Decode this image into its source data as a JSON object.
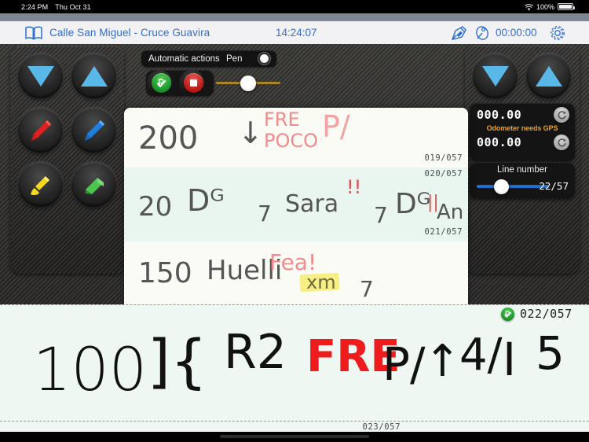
{
  "status_bar": {
    "time": "2:24 PM",
    "date": "Thu Oct 31",
    "battery_percent": "100%",
    "wifi_icon": "wifi-icon",
    "battery_icon": "battery-icon"
  },
  "nav_bar": {
    "book_icon": "book-icon",
    "title": "Calle San Miguel - Cruce Guavira",
    "clock": "14:24:07",
    "pen_icon": "fountain-pen-icon",
    "satellite_icon": "satellite-dish-icon",
    "timer": "00:00:00",
    "gear_icon": "gear-icon"
  },
  "left_tools": [
    {
      "name": "scroll-down-button",
      "icon": "triangle-down-icon",
      "color": "#5ab8e8"
    },
    {
      "name": "scroll-up-button",
      "icon": "triangle-up-icon",
      "color": "#5ab8e8"
    },
    {
      "name": "red-pen-button",
      "icon": "pen-icon",
      "color": "#e2201c"
    },
    {
      "name": "blue-pen-button",
      "icon": "pen-icon",
      "color": "#1f7fe0"
    },
    {
      "name": "yellow-brush-button",
      "icon": "brush-icon",
      "color": "#f2d91e"
    },
    {
      "name": "green-eraser-button",
      "icon": "eraser-icon",
      "color": "#4fc34f"
    }
  ],
  "right_tools": [
    {
      "name": "page-down-button",
      "icon": "triangle-down-icon",
      "color": "#5ab8e8"
    },
    {
      "name": "page-up-button",
      "icon": "triangle-up-icon",
      "color": "#5ab8e8"
    }
  ],
  "toolbar": {
    "automatic_actions_label": "Automatic actions",
    "pen_label": "Pen",
    "pen_toggle_state": "on",
    "park_action_icon": "green-park-check-icon",
    "stop_action_icon": "red-stop-icon",
    "thickness_slider_value": 50
  },
  "odometer": {
    "value_primary": "000.00",
    "value_secondary": "000.00",
    "warning": "Odometer needs GPS",
    "refresh_icon": "refresh-icon"
  },
  "line_number": {
    "label": "Line number",
    "value": "22/57",
    "slider_percent": 38
  },
  "notepad": {
    "rows": [
      {
        "label": "019/057",
        "background": "#fbfbf6",
        "strokes": [
          {
            "text": "200",
            "color": "#555555",
            "style": "pencil"
          },
          {
            "text": "↓",
            "color": "#555555",
            "style": "pencil"
          },
          {
            "text": "FRE",
            "color": "#f08a8a",
            "style": "pen"
          },
          {
            "text": "POCO",
            "color": "#f08a8a",
            "style": "pen"
          },
          {
            "text": "P/",
            "color": "#f0a0a0",
            "style": "pen"
          }
        ]
      },
      {
        "label": "020/057",
        "background": "#e9f5ef",
        "strokes": [
          {
            "text": "20",
            "color": "#555555",
            "style": "pencil"
          },
          {
            "text": "Dᴳ",
            "color": "#555555",
            "style": "pencil"
          },
          {
            "text": "7",
            "color": "#555555",
            "style": "pencil"
          },
          {
            "text": "Sara",
            "color": "#555555",
            "style": "pencil"
          },
          {
            "text": "!!",
            "color": "#e05050",
            "style": "pen"
          },
          {
            "text": "7",
            "color": "#555555",
            "style": "pencil"
          },
          {
            "text": "Dᴳ",
            "color": "#555555",
            "style": "pencil"
          },
          {
            "text": "An",
            "color": "#555555",
            "style": "pencil"
          },
          {
            "text": "||",
            "color": "#e05050",
            "style": "pen"
          }
        ]
      },
      {
        "label": "021/057",
        "background": "#fbfbf6",
        "strokes": [
          {
            "text": "150",
            "color": "#555555",
            "style": "pencil"
          },
          {
            "text": "Huelli",
            "color": "#555555",
            "style": "pencil"
          },
          {
            "text": "Fea!",
            "color": "#f08a8a",
            "style": "pen"
          },
          {
            "text": "xm",
            "color": "#555555",
            "style": "highlight"
          },
          {
            "text": "7",
            "color": "#555555",
            "style": "pencil"
          }
        ]
      }
    ],
    "active_row": {
      "label": "022/057",
      "badge_icon": "green-park-check-icon",
      "background": "#eef7f1",
      "strokes": [
        {
          "text": "100",
          "color": "#111111",
          "style": "marker"
        },
        {
          "text": "]{",
          "color": "#111111",
          "style": "marker"
        },
        {
          "text": "R2",
          "color": "#111111",
          "style": "marker"
        },
        {
          "text": "FRE",
          "color": "#ee1c1c",
          "style": "marker"
        },
        {
          "text": "P/",
          "color": "#111111",
          "style": "marker"
        },
        {
          "text": "↑",
          "color": "#111111",
          "style": "marker"
        },
        {
          "text": "4/",
          "color": "#111111",
          "style": "marker"
        },
        {
          "text": "I",
          "color": "#111111",
          "style": "marker"
        },
        {
          "text": "5",
          "color": "#111111",
          "style": "marker"
        }
      ]
    },
    "next_row_label": "023/057"
  }
}
